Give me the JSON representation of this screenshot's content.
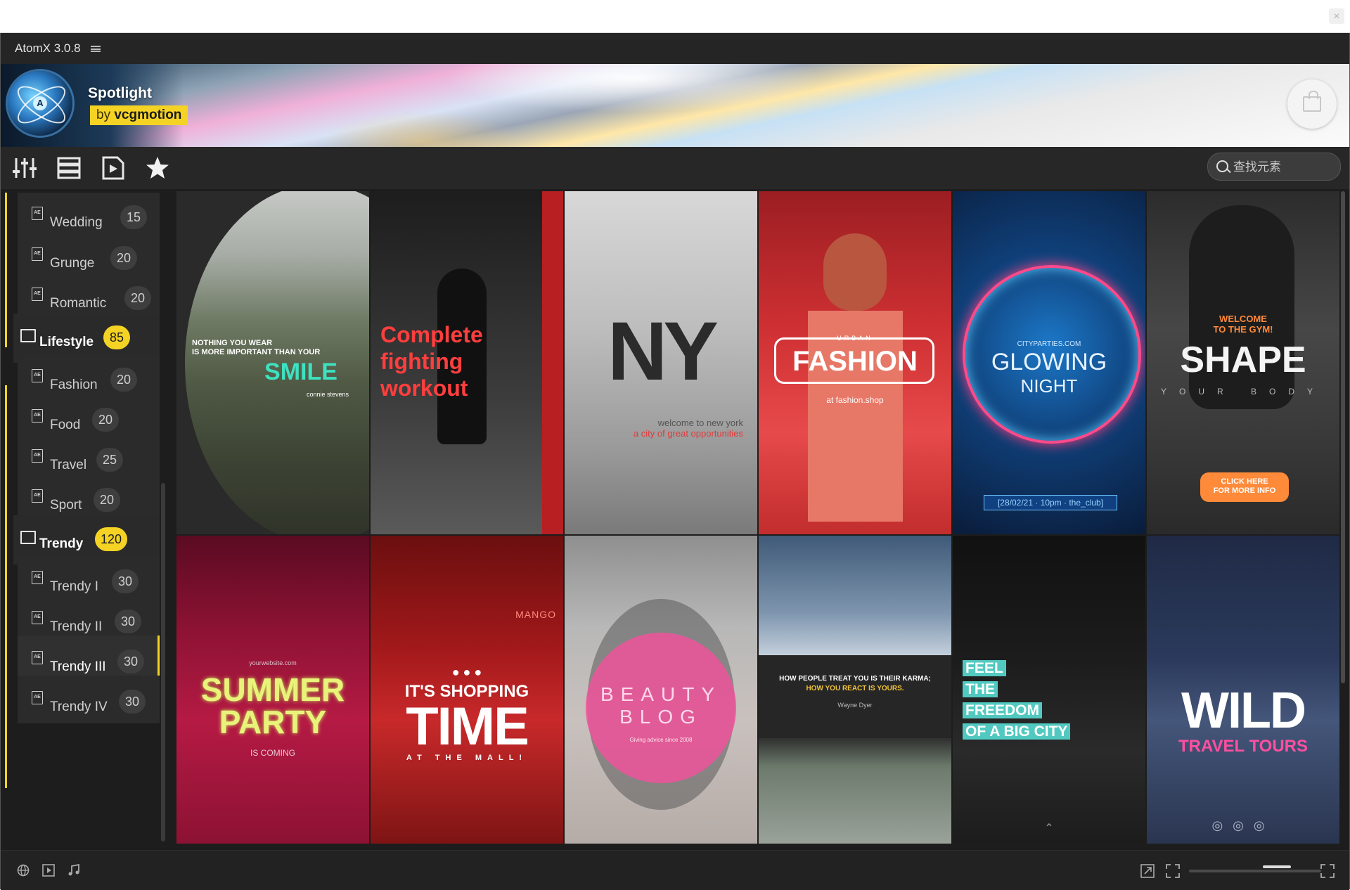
{
  "app": {
    "title": "AtomX 3.0.8"
  },
  "banner": {
    "title": "Spotlight",
    "author_prefix": "by",
    "author": "vcgmotion"
  },
  "search": {
    "placeholder": "查找元素"
  },
  "sidebar": {
    "items": [
      {
        "label": "Wedding",
        "count": "15",
        "kind": "item"
      },
      {
        "label": "Grunge",
        "count": "20",
        "kind": "item"
      },
      {
        "label": "Romantic",
        "count": "20",
        "kind": "item"
      },
      {
        "label": "Lifestyle",
        "count": "85",
        "kind": "category"
      },
      {
        "label": "Fashion",
        "count": "20",
        "kind": "item"
      },
      {
        "label": "Food",
        "count": "20",
        "kind": "item"
      },
      {
        "label": "Travel",
        "count": "25",
        "kind": "item"
      },
      {
        "label": "Sport",
        "count": "20",
        "kind": "item"
      },
      {
        "label": "Trendy",
        "count": "120",
        "kind": "category"
      },
      {
        "label": "Trendy I",
        "count": "30",
        "kind": "item"
      },
      {
        "label": "Trendy II",
        "count": "30",
        "kind": "item"
      },
      {
        "label": "Trendy III",
        "count": "30",
        "kind": "item",
        "active": true
      },
      {
        "label": "Trendy IV",
        "count": "30",
        "kind": "item"
      }
    ]
  },
  "tiles": {
    "t1": {
      "line1": "NOTHING YOU WEAR",
      "line2": "IS MORE IMPORTANT THAN YOUR",
      "big": "SMILE",
      "small": "connie stevens"
    },
    "t2": {
      "line1": "Complete",
      "line2": "fighting",
      "line3": "workout"
    },
    "t3": {
      "big": "NY",
      "line1": "welcome to new york",
      "line2": "a city of great opportunities"
    },
    "t4": {
      "small": "URBAN",
      "big": "FASHION",
      "line1": "at fashion.shop"
    },
    "t5": {
      "small": "CITYPARTIES.COM",
      "line1": "GLOWING",
      "line2": "NIGHT",
      "date": "[28/02/21 · 10pm · the_club]"
    },
    "t6": {
      "line1": "WELCOME",
      "line2": "TO THE GYM!",
      "big": "SHAPE",
      "sub": "YOUR BODY",
      "btn1": "CLICK HERE",
      "btn2": "FOR MORE INFO"
    },
    "t7": {
      "small": "yourwebsite.com",
      "line1": "SUMMER",
      "line2": "PARTY",
      "sub": "IS COMING"
    },
    "t8": {
      "brand": "MANGO",
      "line1": "IT'S SHOPPING",
      "big": "TIME",
      "sub": "AT THE MALL!"
    },
    "t9": {
      "line1": "BEAUTY",
      "line2": "BLOG",
      "small": "Giving advice since 2008"
    },
    "t10": {
      "line1": "HOW PEOPLE TREAT YOU IS THEIR KARMA;",
      "line2": "HOW YOU REACT IS YOURS.",
      "small": "Wayne Dyer"
    },
    "t11": {
      "l1": "FEEL",
      "l2": "THE",
      "l3": "FREEDOM",
      "l4": "OF A BIG CITY"
    },
    "t12": {
      "big": "WILD",
      "sub": "TRAVEL TOURS"
    }
  },
  "colors": {
    "accent": "#f5d324",
    "panel": "#1d1d1d"
  }
}
